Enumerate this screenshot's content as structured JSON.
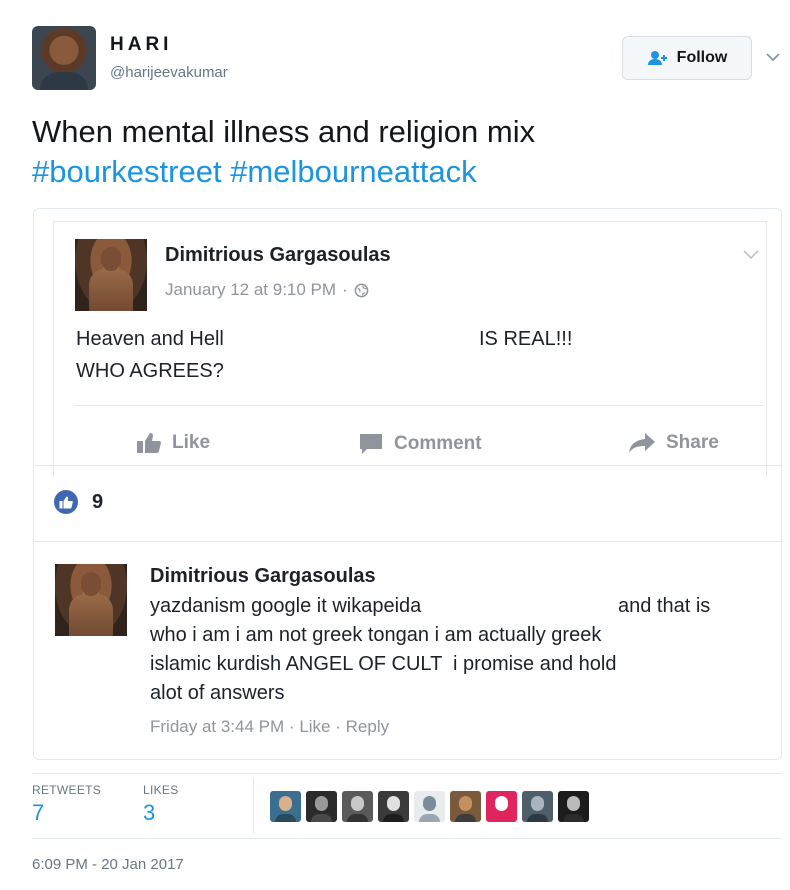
{
  "tweet": {
    "display_name": "HARI",
    "handle": "@harijeevakumar",
    "follow_label": "Follow",
    "text": "When mental illness and religion mix",
    "hashtags": [
      "#bourkestreet",
      "#melbourneattack"
    ],
    "timestamp": "6:09 PM - 20 Jan 2017"
  },
  "fb_post": {
    "author": "Dimitrious Gargasoulas",
    "date": "January 12 at 9:10 PM",
    "separator": "·",
    "line1a": "Heaven and Hell",
    "line1b": "IS REAL!!!",
    "line2": "WHO AGREES?",
    "actions": {
      "like": "Like",
      "comment": "Comment",
      "share": "Share"
    },
    "like_count": "9",
    "comment": {
      "author": "Dimitrious Gargasoulas",
      "line1a": "yazdanism google it wikapeida",
      "line1b": "and that is",
      "line2": "who i am i am not greek tongan i am actually greek",
      "line3": "islamic kurdish ANGEL OF CULT  i promise and hold",
      "line4": "alot of answers",
      "time": "Friday at 3:44 PM",
      "like": "Like",
      "reply": "Reply"
    }
  },
  "stats": {
    "retweets_label": "RETWEETS",
    "retweets": "7",
    "likes_label": "LIKES",
    "likes": "3"
  },
  "colors": {
    "twitter_blue": "#1b95e0",
    "fb_blue": "#4267b2",
    "muted": "#90949c"
  },
  "likers": [
    {
      "icon": "liker-avatar-1",
      "bg": "#3c6e8f",
      "head": "#d9b08c",
      "body": "#2a4a60"
    },
    {
      "icon": "liker-avatar-2",
      "bg": "#2b2b2b",
      "head": "#9a9a9a",
      "body": "#4a4a4a"
    },
    {
      "icon": "liker-avatar-3",
      "bg": "#5a5a5a",
      "head": "#c8c8c8",
      "body": "#333333"
    },
    {
      "icon": "liker-avatar-4",
      "bg": "#3a3a3a",
      "head": "#e0e0e0",
      "body": "#1e1e1e"
    },
    {
      "icon": "liker-avatar-5",
      "bg": "#e8ecef",
      "head": "#7b8c99",
      "body": "#9aa7b1"
    },
    {
      "icon": "liker-avatar-6",
      "bg": "#7a5a3c",
      "head": "#c59060",
      "body": "#3d3d3d"
    },
    {
      "icon": "liker-avatar-7",
      "bg": "#e0245e",
      "head": "#ffffff",
      "body": "#e0245e"
    },
    {
      "icon": "liker-avatar-8",
      "bg": "#4e5f6c",
      "head": "#a8b5bf",
      "body": "#2d3a44"
    },
    {
      "icon": "liker-avatar-9",
      "bg": "#1c1c1c",
      "head": "#bbbbbb",
      "body": "#2c2c2c"
    }
  ]
}
